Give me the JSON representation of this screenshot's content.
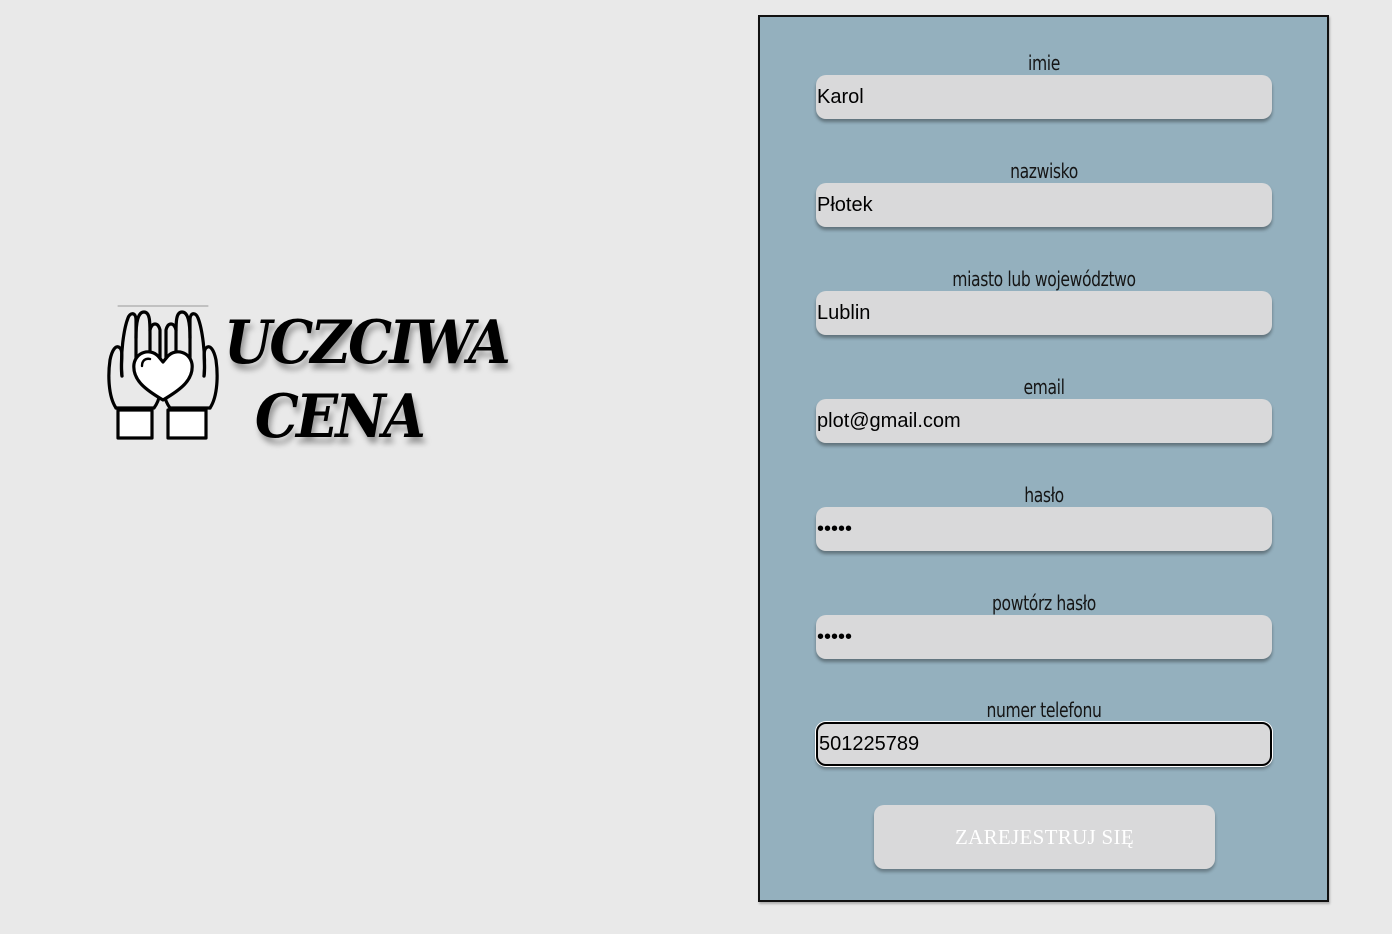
{
  "logo": {
    "icon": "hands-heart-icon",
    "line1": "UCZCIWA",
    "line2": "CENA"
  },
  "form": {
    "fields": [
      {
        "label": "imie",
        "value": "Karol",
        "type": "text"
      },
      {
        "label": "nazwisko",
        "value": "Płotek",
        "type": "text"
      },
      {
        "label": "miasto lub województwo",
        "value": "Lublin",
        "type": "text"
      },
      {
        "label": "email",
        "value": "plot@gmail.com",
        "type": "text"
      },
      {
        "label": "hasło",
        "value": "•••••",
        "type": "password"
      },
      {
        "label": "powtórz hasło",
        "value": "•••••",
        "type": "password"
      },
      {
        "label": "numer telefonu",
        "value": "501225789",
        "type": "text"
      }
    ],
    "submit_label": "ZAREJESTRUJ SIĘ"
  },
  "colors": {
    "background": "#e9e9e9",
    "panel": "#94b0be",
    "input": "#d9d9da"
  }
}
